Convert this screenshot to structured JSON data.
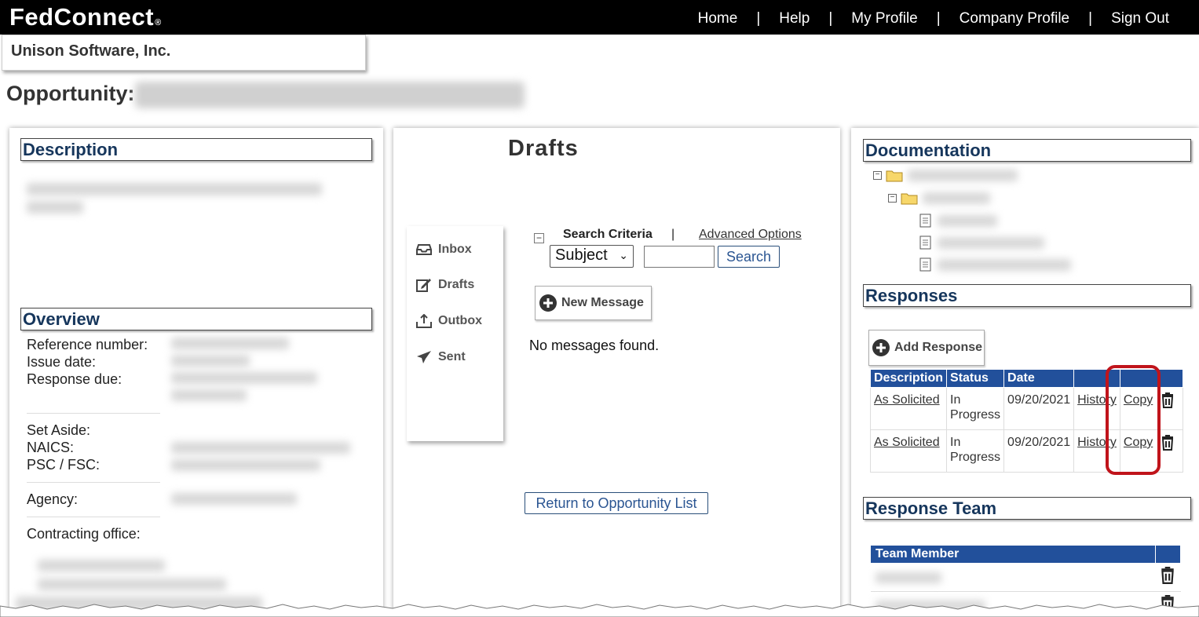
{
  "brand": {
    "logo": "FedConnect",
    "reg": "®"
  },
  "nav": [
    "Home",
    "Help",
    "My Profile",
    "Company Profile",
    "Sign Out"
  ],
  "company": "Unison Software, Inc.",
  "opportunity_label": "Opportunity:",
  "description": {
    "heading": "Description"
  },
  "overview": {
    "heading": "Overview",
    "fields": {
      "reference": "Reference number:",
      "issue": "Issue date:",
      "due": "Response due:",
      "setaside": "Set Aside:",
      "naics": "NAICS:",
      "psc": "PSC / FSC:",
      "agency": "Agency:",
      "office": "Contracting office:"
    }
  },
  "drafts": {
    "title": "Drafts",
    "mailbox": [
      "Inbox",
      "Drafts",
      "Outbox",
      "Sent"
    ],
    "search_criteria": "Search Criteria",
    "advanced": "Advanced Options",
    "subject_select": "Subject",
    "search_button": "Search",
    "new_message": "New Message",
    "no_messages": "No messages found.",
    "return_button": "Return to Opportunity List"
  },
  "documentation": {
    "heading": "Documentation"
  },
  "responses": {
    "heading": "Responses",
    "add_button": "Add Response",
    "columns": [
      "Description",
      "Status",
      "Date"
    ],
    "rows": [
      {
        "description": "As Solicited",
        "status_line1": "In",
        "status_line2": "Progress",
        "date": "09/20/2021",
        "history": "History",
        "copy": "Copy"
      },
      {
        "description": "As Solicited",
        "status_line1": "In",
        "status_line2": "Progress",
        "date": "09/20/2021",
        "history": "History",
        "copy": "Copy"
      }
    ]
  },
  "team": {
    "heading": "Response Team",
    "column": "Team Member"
  },
  "colors": {
    "header_bg": "#000000",
    "table_header": "#22509b",
    "section_text": "#16365c",
    "highlight": "#c0141b"
  }
}
